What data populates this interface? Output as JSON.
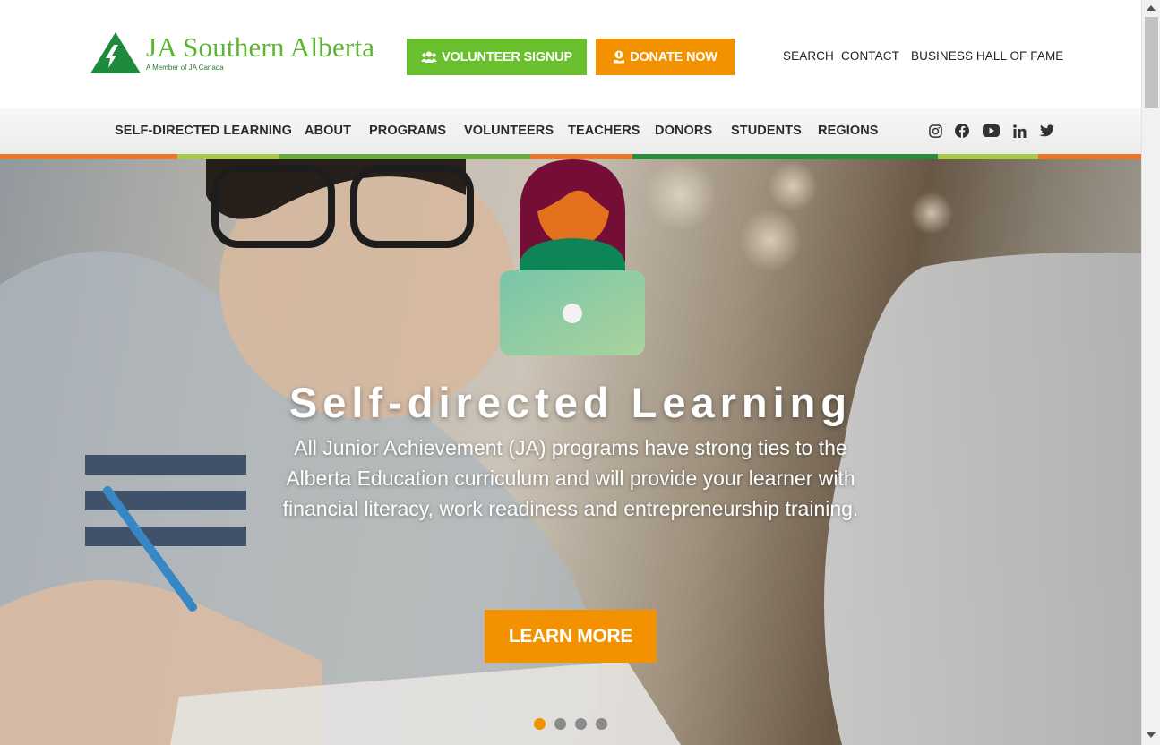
{
  "brand": {
    "name": "JA Southern Alberta",
    "tagline": "A Member of JA Canada",
    "colors": {
      "green": "#6abf2e",
      "dark_green": "#2c7a3a",
      "orange": "#f39200"
    }
  },
  "header": {
    "volunteer_button": {
      "label": "VOLUNTEER SIGNUP",
      "icon": "users-icon"
    },
    "donate_button": {
      "label": "DONATE NOW",
      "icon": "donate-hand-icon"
    },
    "utility_links": [
      "SEARCH",
      "CONTACT",
      "BUSINESS HALL OF FAME"
    ]
  },
  "nav": {
    "items": [
      "SELF-DIRECTED LEARNING",
      "ABOUT",
      "PROGRAMS",
      "VOLUNTEERS",
      "TEACHERS",
      "DONORS",
      "STUDENTS",
      "REGIONS"
    ],
    "social": [
      "instagram-icon",
      "facebook-icon",
      "youtube-icon",
      "linkedin-icon",
      "twitter-icon"
    ]
  },
  "hero": {
    "title": "Self-directed Learning",
    "text": "All Junior Achievement (JA) programs have strong ties to the Alberta Education curriculum and will provide your learner with financial literacy, work readiness and entrepreneurship training.",
    "cta": "LEARN MORE",
    "slides": 4,
    "active_slide": 1
  }
}
